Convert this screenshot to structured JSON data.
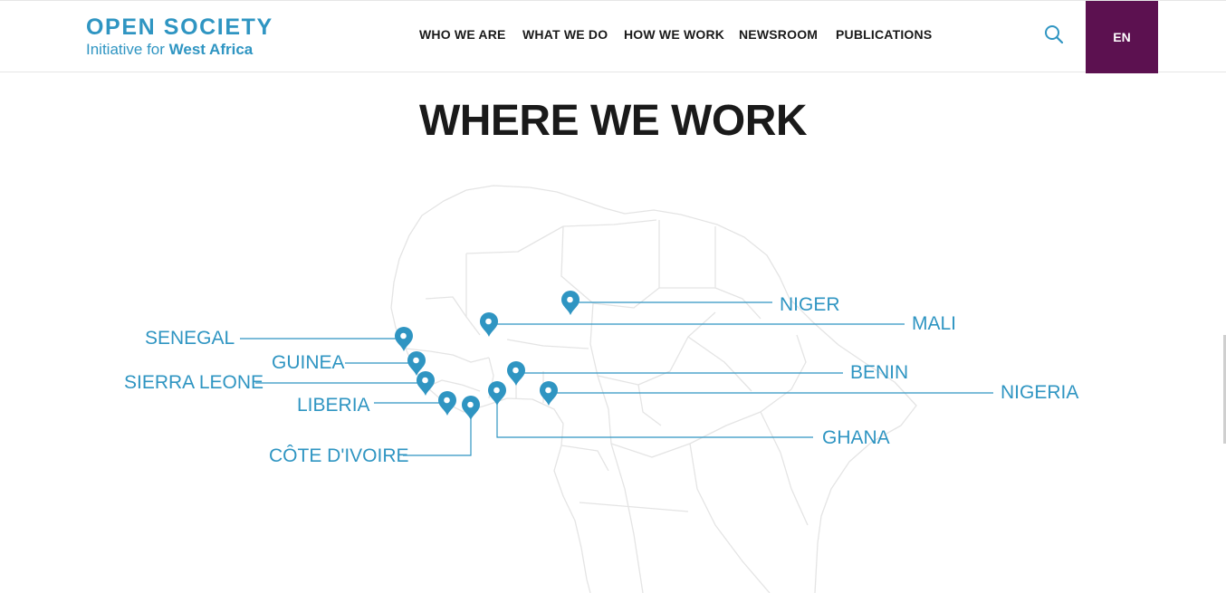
{
  "header": {
    "logo": {
      "line1": "OPEN SOCIETY",
      "line2_prefix": "Initiative for ",
      "line2_emph": "West Africa"
    },
    "nav": [
      "WHO WE ARE",
      "WHAT WE DO",
      "HOW WE WORK",
      "NEWSROOM",
      "PUBLICATIONS"
    ],
    "search_icon": "search-icon",
    "language": "EN"
  },
  "main": {
    "title": "WHERE WE WORK",
    "countries": [
      "SENEGAL",
      "GUINEA",
      "SIERRA LEONE",
      "LIBERIA",
      "CÔTE D'IVOIRE",
      "NIGER",
      "MALI",
      "BENIN",
      "NIGERIA",
      "GHANA"
    ]
  },
  "colors": {
    "accent": "#2f95c2",
    "language_bg": "#5c1150",
    "map_lines": "#e4e4e4"
  }
}
